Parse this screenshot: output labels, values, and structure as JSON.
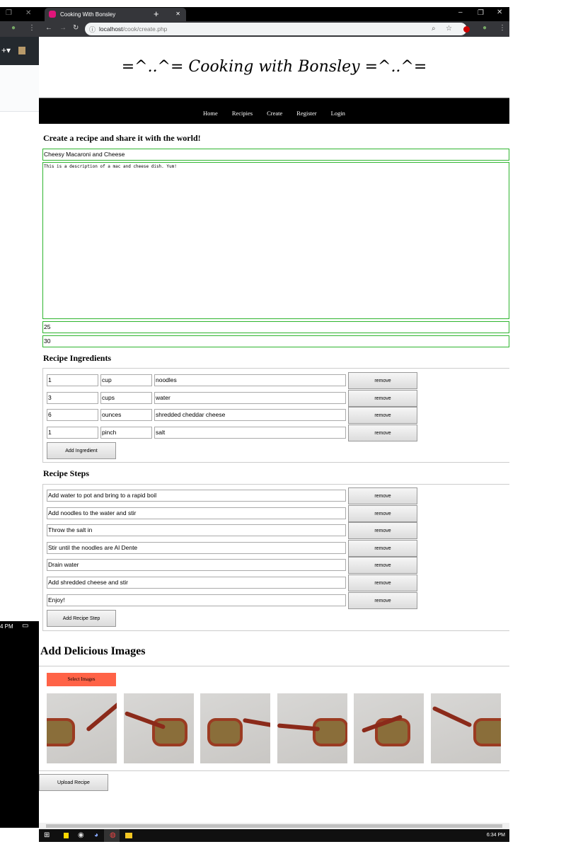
{
  "browser": {
    "tab_title": "Cooking With Bonsley",
    "url_host": "localhost",
    "url_path": "/cook/create.php"
  },
  "site": {
    "logo": "=^..^= Cooking with Bonsley =^..^=",
    "nav": [
      "Home",
      "Recipies",
      "Create",
      "Register",
      "Login"
    ]
  },
  "form": {
    "heading": "Create a recipe and share it with the world!",
    "title": "Cheesy Macaroni and Cheese",
    "description": "This is a description of a mac and cheese dish. Yum!",
    "field1": "25",
    "field2": "30"
  },
  "ingredients": {
    "heading": "Recipe Ingredients",
    "rows": [
      {
        "qty": "1",
        "unit": "cup",
        "name": "noodles"
      },
      {
        "qty": "3",
        "unit": "cups",
        "name": "water"
      },
      {
        "qty": "6",
        "unit": "ounces",
        "name": "shredded cheddar cheese"
      },
      {
        "qty": "1",
        "unit": "pinch",
        "name": "salt"
      }
    ],
    "remove_label": "remove",
    "add_label": "Add Ingredient"
  },
  "steps": {
    "heading": "Recipe Steps",
    "rows": [
      "Add water to pot and bring to a rapid boil",
      "Add noodles to the water and stir",
      "Throw the salt in",
      "Stir until the noodles are Al Dente",
      "Drain water",
      "Add shredded cheese and stir",
      "Enjoy!"
    ],
    "remove_label": "remove",
    "add_label": "Add Recipe Step"
  },
  "images": {
    "heading": "Add Delicious Images",
    "select_label": "Select Images",
    "select_color": "#ff6347"
  },
  "upload_label": "Upload Recipe",
  "taskbar": {
    "time": "6:34 PM",
    "left_time": "4 PM"
  }
}
